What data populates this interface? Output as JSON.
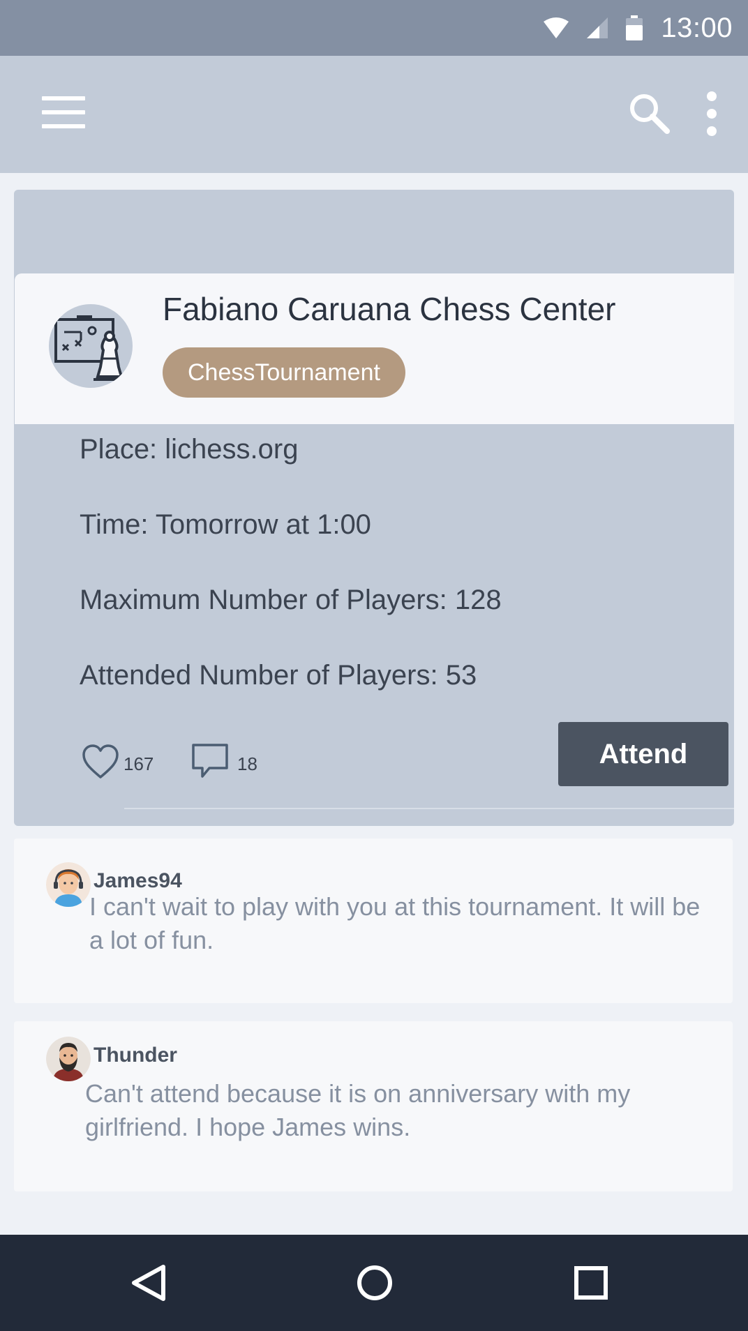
{
  "status_bar": {
    "time": "13:00",
    "icons": [
      "wifi-icon",
      "cell-signal-icon",
      "battery-icon"
    ]
  },
  "app_bar": {
    "icons": [
      "menu-icon",
      "search-icon",
      "more-vert-icon"
    ]
  },
  "event": {
    "organizer": "Fabiano Caruana Chess Center",
    "tag": "ChessTournament",
    "place": "Place: lichess.org",
    "time": "Time: Tomorrow at 1:00",
    "max_players": "Maximum Number of Players: 128",
    "attended_players": "Attended Number of Players: 53",
    "likes": "167",
    "comments_count": "18",
    "attend_label": "Attend",
    "icons": [
      "chess-strategy-icon",
      "heart-icon",
      "comment-icon"
    ]
  },
  "comments": [
    {
      "author": "James94",
      "text": "I can't wait to play with you at this tournament. It will be a lot of fun."
    },
    {
      "author": "Thunder",
      "text": "Can't attend because it is on anniversary with my girlfriend. I hope James wins."
    }
  ],
  "nav_bar": {
    "icons": [
      "back-icon",
      "home-icon",
      "recents-icon"
    ]
  },
  "colors": {
    "status_bar": "#8490a3",
    "app_bar": "#c2cbd8",
    "tag": "#b49a80",
    "attend_button": "#4b5461",
    "nav_bar": "#222a39"
  }
}
